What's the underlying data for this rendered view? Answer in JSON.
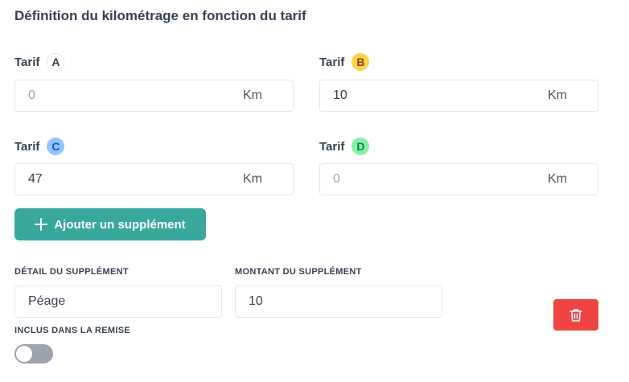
{
  "section_title": "Définition du kilométrage en fonction du tarif",
  "tarifs": [
    {
      "label": "Tarif",
      "badge": "A",
      "value": "",
      "placeholder": "0",
      "unit": "Km"
    },
    {
      "label": "Tarif",
      "badge": "B",
      "value": "10",
      "placeholder": "0",
      "unit": "Km"
    },
    {
      "label": "Tarif",
      "badge": "C",
      "value": "47",
      "placeholder": "0",
      "unit": "Km"
    },
    {
      "label": "Tarif",
      "badge": "D",
      "value": "",
      "placeholder": "0",
      "unit": "Km"
    }
  ],
  "add_button": {
    "label": "Ajouter un supplément",
    "icon": "plus-icon"
  },
  "supplement": {
    "detail_label": "DÉTAIL DU SUPPLÉMENT",
    "detail_value": "Péage",
    "amount_label": "MONTANT DU SUPPLÉMENT",
    "amount_value": "10",
    "included_label": "INCLUS DANS LA REMISE",
    "included_on": false,
    "delete_icon": "trash-icon"
  },
  "colors": {
    "accent": "#38a89d",
    "danger": "#ef4444",
    "badge_a": "#ffffff",
    "badge_b": "#fcd34d",
    "badge_c": "#93c5fd",
    "badge_d": "#86efac",
    "toggle_off": "#9ca3af"
  }
}
